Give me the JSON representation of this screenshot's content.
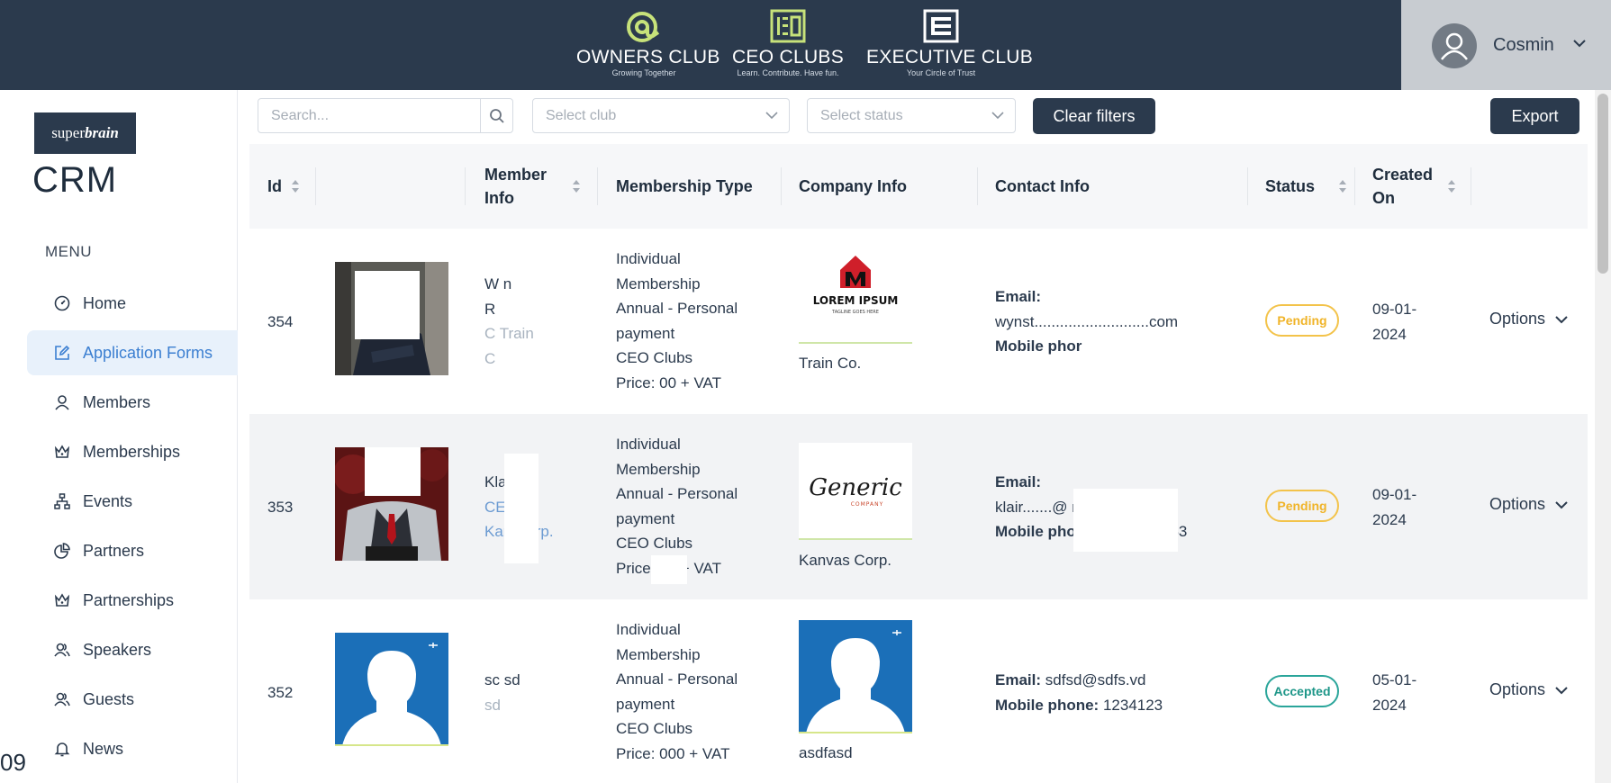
{
  "header": {
    "brands": [
      {
        "name": "OWNERS CLUB",
        "tagline": "Growing Together"
      },
      {
        "name": "CEO CLUBS",
        "tagline": "Learn. Contribute. Have fun."
      },
      {
        "name": "EXECUTIVE CLUB",
        "tagline": "Your Circle of Trust"
      }
    ],
    "user": {
      "name": "Cosmin"
    }
  },
  "sidebar": {
    "logo_prefix": "super",
    "logo_suffix": "brain",
    "title": "CRM",
    "menu_label": "MENU",
    "items": [
      {
        "label": "Home",
        "icon": "dashboard-icon",
        "active": false
      },
      {
        "label": "Application Forms",
        "icon": "edit-icon",
        "active": true
      },
      {
        "label": "Members",
        "icon": "user-icon",
        "active": false
      },
      {
        "label": "Memberships",
        "icon": "crown-icon",
        "active": false
      },
      {
        "label": "Events",
        "icon": "sitemap-icon",
        "active": false
      },
      {
        "label": "Partners",
        "icon": "pie-chart-icon",
        "active": false
      },
      {
        "label": "Partnerships",
        "icon": "crown-icon",
        "active": false
      },
      {
        "label": "Speakers",
        "icon": "users-icon",
        "active": false
      },
      {
        "label": "Guests",
        "icon": "users-icon",
        "active": false
      },
      {
        "label": "News",
        "icon": "bell-icon",
        "active": false
      }
    ],
    "page_fragment": "09"
  },
  "filters": {
    "search_placeholder": "Search...",
    "club_placeholder": "Select club",
    "status_placeholder": "Select status",
    "clear_label": "Clear filters",
    "export_label": "Export"
  },
  "table": {
    "headers": {
      "id": "Id",
      "member_line1": "Member",
      "member_line2": "Info",
      "membership": "Membership Type",
      "company": "Company Info",
      "contact": "Contact Info",
      "status": "Status",
      "created_line1": "Created",
      "created_line2": "On"
    },
    "rows": [
      {
        "id": "354",
        "member_lines": [
          "W       n",
          "R",
          "C         Train",
          "C"
        ],
        "membership_lines": [
          "Individual",
          "Membership",
          "Annual - Personal",
          "payment",
          "CEO Clubs",
          "Price:        00 + VAT"
        ],
        "company_logo_text": "LOREM IPSUM",
        "company_logo_sub": "TAGLINE GOES HERE",
        "company_name": "Train Co.",
        "email_label": "Email:",
        "email_value": "wynst...........................com",
        "phone_label": "Mobile phor",
        "phone_value": "",
        "status": "Pending",
        "created_lines": [
          "09-01-",
          "2024"
        ],
        "options_label": "Options"
      },
      {
        "id": "353",
        "member_lines": [
          "Kla        maj",
          "CEO",
          "Kan        Corp."
        ],
        "membership_lines": [
          "Individual",
          "Membership",
          "Annual - Personal",
          "payment",
          "CEO Clubs",
          "Price:       00 + VAT"
        ],
        "company_logo_text": "Generic",
        "company_logo_sub": "COMPANY",
        "company_name": "Kanvas Corp.",
        "email_label": "Email:",
        "email_value": "klair.......@            m",
        "phone_label": "Mobile pho",
        "phone_value": "53",
        "status": "Pending",
        "created_lines": [
          "09-01-",
          "2024"
        ],
        "options_label": "Options"
      },
      {
        "id": "352",
        "member_lines": [
          "sc           sd",
          "sd"
        ],
        "membership_lines": [
          "Individual",
          "Membership",
          "Annual - Personal",
          "payment",
          "CEO Clubs",
          "Price:       000 + VAT"
        ],
        "company_logo_text": "",
        "company_logo_sub": "",
        "company_name": "asdfasd",
        "email_label": "Email:",
        "email_value": "sdfsd@sdfs.vd",
        "phone_label": "Mobile phone:",
        "phone_value": "1234123",
        "status": "Accepted",
        "created_lines": [
          "05-01-",
          "2024"
        ],
        "options_label": "Options"
      }
    ]
  },
  "colors": {
    "header_bg": "#2b3a4d",
    "active_nav_bg": "#e8f1fb",
    "active_nav_text": "#3b7fd1",
    "pending": "#f0b429",
    "accepted": "#1d9688"
  }
}
